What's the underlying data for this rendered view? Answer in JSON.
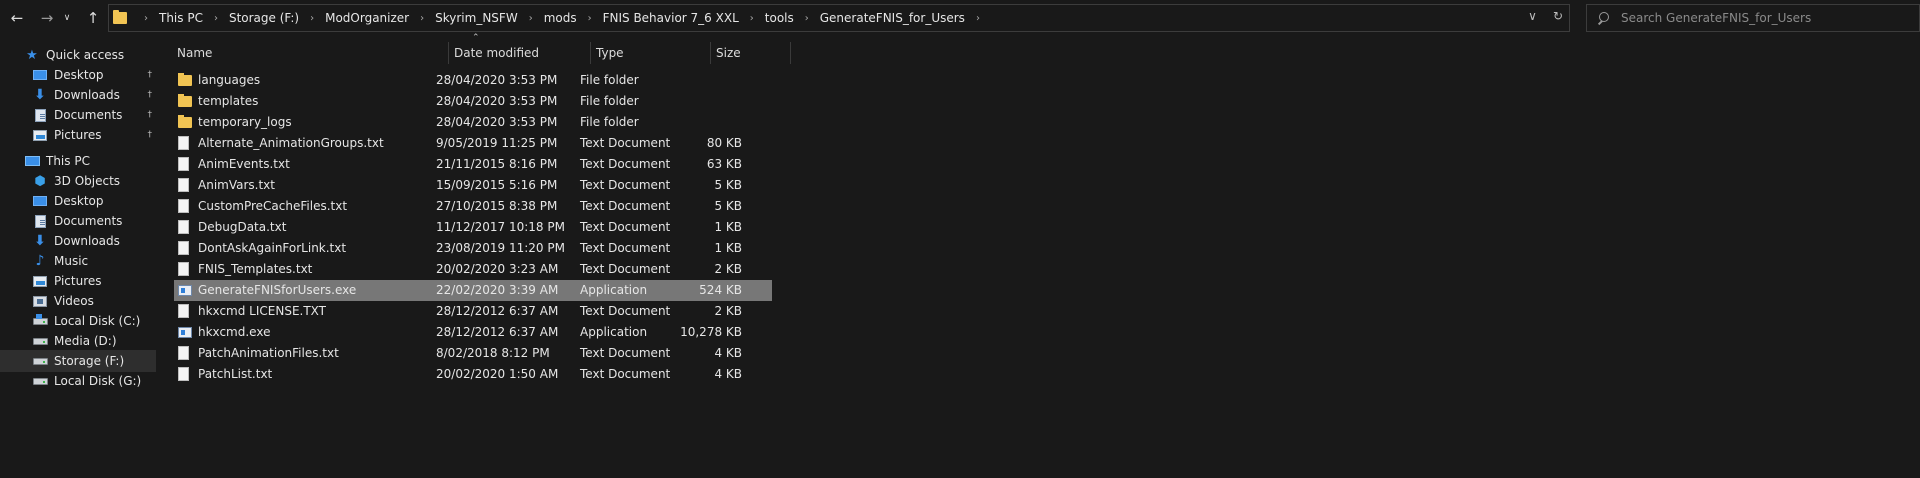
{
  "nav": {
    "back_icon": "arrow-left-icon",
    "forward_icon": "arrow-right-icon",
    "recent_icon": "chevron-down-icon",
    "up_icon": "arrow-up-icon"
  },
  "address": {
    "breadcrumbs": [
      "This PC",
      "Storage (F:)",
      "ModOrganizer",
      "Skyrim_NSFW",
      "mods",
      "FNIS Behavior 7_6 XXL",
      "tools",
      "GenerateFNIS_for_Users"
    ]
  },
  "search": {
    "placeholder": "Search GenerateFNIS_for_Users"
  },
  "sidebar": {
    "items": [
      {
        "label": "Quick access",
        "icon": "star-icon",
        "pinned": false
      },
      {
        "label": "Desktop",
        "icon": "desktop-icon",
        "pinned": true
      },
      {
        "label": "Downloads",
        "icon": "download-icon",
        "pinned": true
      },
      {
        "label": "Documents",
        "icon": "documents-icon",
        "pinned": true
      },
      {
        "label": "Pictures",
        "icon": "pictures-icon",
        "pinned": true
      },
      {
        "label": "This PC",
        "icon": "computer-icon",
        "pinned": false
      },
      {
        "label": "3D Objects",
        "icon": "cube-icon",
        "pinned": false
      },
      {
        "label": "Desktop",
        "icon": "desktop-icon",
        "pinned": false
      },
      {
        "label": "Documents",
        "icon": "documents-icon",
        "pinned": false
      },
      {
        "label": "Downloads",
        "icon": "download-icon",
        "pinned": false
      },
      {
        "label": "Music",
        "icon": "music-icon",
        "pinned": false
      },
      {
        "label": "Pictures",
        "icon": "pictures-icon",
        "pinned": false
      },
      {
        "label": "Videos",
        "icon": "videos-icon",
        "pinned": false
      },
      {
        "label": "Local Disk (C:)",
        "icon": "drive-icon",
        "pinned": false
      },
      {
        "label": "Media (D:)",
        "icon": "drive-icon",
        "pinned": false
      },
      {
        "label": "Storage (F:)",
        "icon": "drive-icon",
        "pinned": false,
        "selected": true
      },
      {
        "label": "Local Disk (G:)",
        "icon": "drive-icon",
        "pinned": false
      }
    ]
  },
  "columns": {
    "name": "Name",
    "date": "Date modified",
    "type": "Type",
    "size": "Size"
  },
  "files": [
    {
      "name": "languages",
      "date": "28/04/2020 3:53 PM",
      "type": "File folder",
      "size": "",
      "icon": "folder-icon"
    },
    {
      "name": "templates",
      "date": "28/04/2020 3:53 PM",
      "type": "File folder",
      "size": "",
      "icon": "folder-icon"
    },
    {
      "name": "temporary_logs",
      "date": "28/04/2020 3:53 PM",
      "type": "File folder",
      "size": "",
      "icon": "folder-icon"
    },
    {
      "name": "Alternate_AnimationGroups.txt",
      "date": "9/05/2019 11:25 PM",
      "type": "Text Document",
      "size": "80 KB",
      "icon": "text-file-icon"
    },
    {
      "name": "AnimEvents.txt",
      "date": "21/11/2015 8:16 PM",
      "type": "Text Document",
      "size": "63 KB",
      "icon": "text-file-icon"
    },
    {
      "name": "AnimVars.txt",
      "date": "15/09/2015 5:16 PM",
      "type": "Text Document",
      "size": "5 KB",
      "icon": "text-file-icon"
    },
    {
      "name": "CustomPreCacheFiles.txt",
      "date": "27/10/2015 8:38 PM",
      "type": "Text Document",
      "size": "5 KB",
      "icon": "text-file-icon"
    },
    {
      "name": "DebugData.txt",
      "date": "11/12/2017 10:18 PM",
      "type": "Text Document",
      "size": "1 KB",
      "icon": "text-file-icon"
    },
    {
      "name": "DontAskAgainForLink.txt",
      "date": "23/08/2019 11:20 PM",
      "type": "Text Document",
      "size": "1 KB",
      "icon": "text-file-icon"
    },
    {
      "name": "FNIS_Templates.txt",
      "date": "20/02/2020 3:23 AM",
      "type": "Text Document",
      "size": "2 KB",
      "icon": "text-file-icon"
    },
    {
      "name": "GenerateFNISforUsers.exe",
      "date": "22/02/2020 3:39 AM",
      "type": "Application",
      "size": "524 KB",
      "icon": "application-icon",
      "selected": true
    },
    {
      "name": "hkxcmd LICENSE.TXT",
      "date": "28/12/2012 6:37 AM",
      "type": "Text Document",
      "size": "2 KB",
      "icon": "text-file-icon"
    },
    {
      "name": "hkxcmd.exe",
      "date": "28/12/2012 6:37 AM",
      "type": "Application",
      "size": "10,278 KB",
      "icon": "application-icon"
    },
    {
      "name": "PatchAnimationFiles.txt",
      "date": "8/02/2018 8:12 PM",
      "type": "Text Document",
      "size": "4 KB",
      "icon": "text-file-icon"
    },
    {
      "name": "PatchList.txt",
      "date": "20/02/2020 1:50 AM",
      "type": "Text Document",
      "size": "4 KB",
      "icon": "text-file-icon"
    }
  ],
  "colors": {
    "background": "#191919",
    "selection": "#777777",
    "accent": "#3a8fe8",
    "folder": "#f1c453"
  }
}
